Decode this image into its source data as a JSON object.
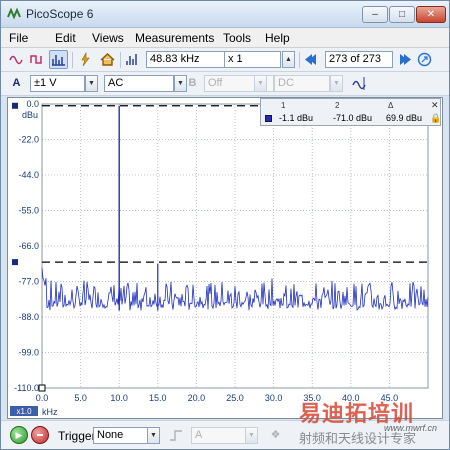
{
  "window": {
    "title": "PicoScope 6"
  },
  "menu": [
    {
      "id": "file",
      "label": "File"
    },
    {
      "id": "edit",
      "label": "Edit"
    },
    {
      "id": "views",
      "label": "Views"
    },
    {
      "id": "measurements",
      "label": "Measurements"
    },
    {
      "id": "tools",
      "label": "Tools"
    },
    {
      "id": "help",
      "label": "Help"
    }
  ],
  "toolbar": {
    "sample_rate": "48.83 kHz",
    "zoom": "x 1",
    "buffer_position": "273 of 273"
  },
  "channel_toolbar": {
    "channel_letter": "A",
    "range": "±1 V",
    "coupling": "AC",
    "probe_letter": "B",
    "filter": "Off",
    "coupling_b": "DC"
  },
  "y_axis": {
    "unit": "dBu",
    "ticks": [
      "0.0",
      "-22.0",
      "-44.0",
      "-55.0",
      "-66.0",
      "-77.0",
      "-88.0",
      "-99.0",
      "-110.0"
    ]
  },
  "x_axis": {
    "ticks": [
      "0.0",
      "5.0",
      "10.0",
      "15.0",
      "20.0",
      "25.0",
      "30.0",
      "35.0",
      "40.0",
      "45.0"
    ],
    "unit": "kHz",
    "scale_badge": "x1.0"
  },
  "ruler_panel": {
    "headers": [
      "1",
      "2",
      "Δ"
    ],
    "values": [
      "-1.1 dBu",
      "-71.0 dBu",
      "69.9 dBu"
    ]
  },
  "statusbar": {
    "trigger_label": "Trigger",
    "trigger_mode": "None",
    "trigger_channel": "A"
  },
  "watermark": {
    "big": "易迪拓培训",
    "url": "www.mwrf.cn",
    "small": "射频和天线设计专家"
  },
  "colors": {
    "trace": "#1f2fbf",
    "ruler": "#000000",
    "grid": "#9aa6b4"
  },
  "chart_data": {
    "type": "line",
    "title": "",
    "xlabel": "kHz",
    "ylabel": "dBu",
    "xlim": [
      0,
      50
    ],
    "ylim": [
      -110,
      0
    ],
    "grid": true,
    "series": [
      {
        "name": "A",
        "x": [
          10.0
        ],
        "values": [
          -1.1
        ]
      }
    ],
    "rulers": {
      "ruler1": -1.1,
      "ruler2": -71.0,
      "delta": 69.9
    },
    "noise_floor_db": [
      -84,
      -76
    ],
    "spurs_khz": [
      15.0
    ]
  }
}
